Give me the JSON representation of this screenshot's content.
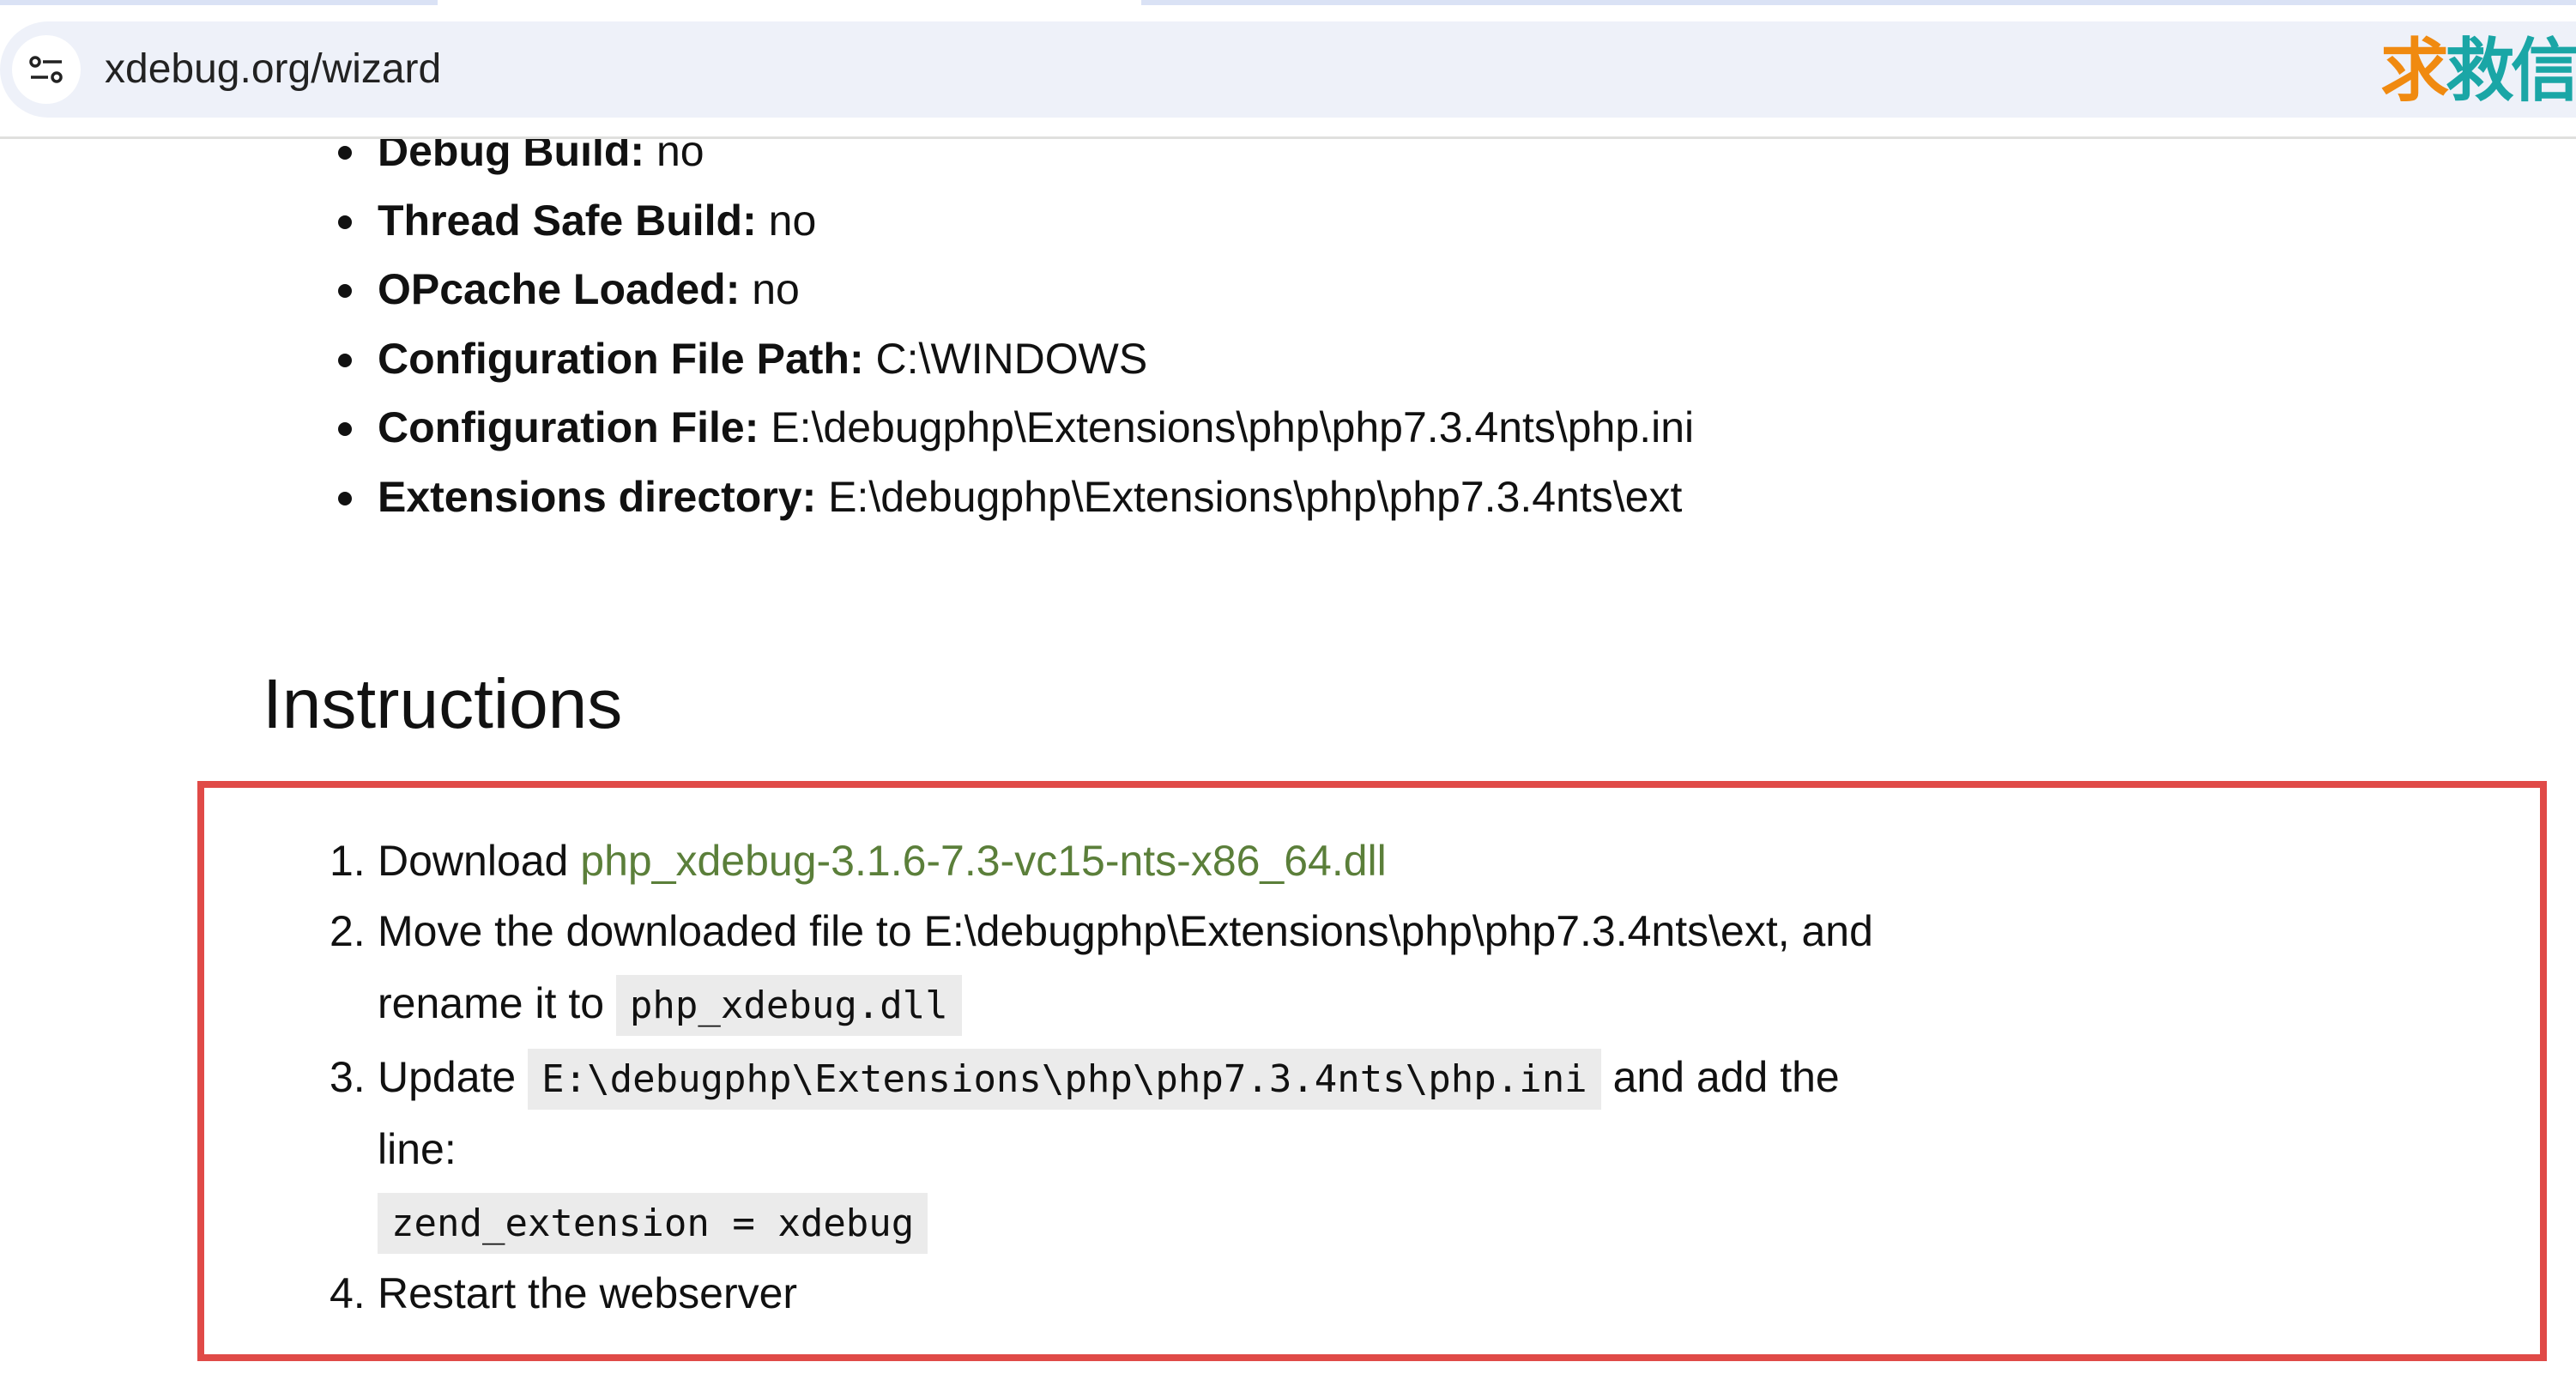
{
  "browser": {
    "url": "xdebug.org/wizard",
    "watermark": [
      "求",
      "救信"
    ]
  },
  "info": [
    {
      "label": "Debug Build:",
      "value": "no"
    },
    {
      "label": "Thread Safe Build:",
      "value": "no"
    },
    {
      "label": "OPcache Loaded:",
      "value": "no"
    },
    {
      "label": "Configuration File Path:",
      "value": "C:\\WINDOWS"
    },
    {
      "label": "Configuration File:",
      "value": "E:\\debugphp\\Extensions\\php\\php7.3.4nts\\php.ini"
    },
    {
      "label": "Extensions directory:",
      "value": "E:\\debugphp\\Extensions\\php\\php7.3.4nts\\ext"
    }
  ],
  "instructions": {
    "heading": "Instructions",
    "step1": {
      "num": "1.",
      "text": "Download ",
      "link": "php_xdebug-3.1.6-7.3-vc15-nts-x86_64.dll"
    },
    "step2": {
      "num": "2.",
      "text": "Move the downloaded file to E:\\debugphp\\Extensions\\php\\php7.3.4nts\\ext, and",
      "text2": "rename it to ",
      "code": "php_xdebug.dll"
    },
    "step3": {
      "num": "3.",
      "text": "Update ",
      "code": "E:\\debugphp\\Extensions\\php\\php7.3.4nts\\php.ini",
      "text_after": " and add the",
      "text2": "line:",
      "code2": "zend_extension = xdebug"
    },
    "step4": {
      "num": "4.",
      "text": "Restart the webserver"
    }
  }
}
